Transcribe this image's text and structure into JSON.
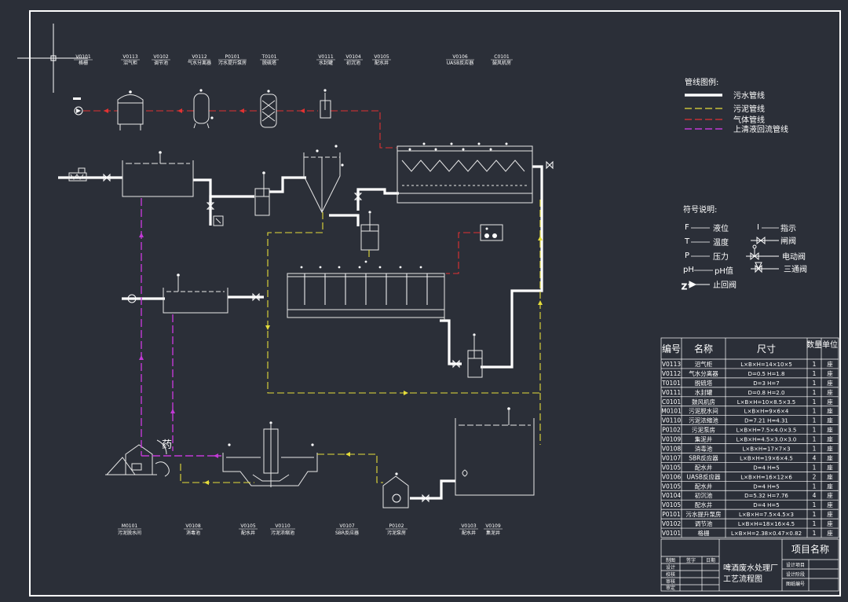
{
  "top_labels": [
    {
      "code": "V0101",
      "name": "格栅"
    },
    {
      "code": "V0113",
      "name": "沼气柜"
    },
    {
      "code": "V0102",
      "name": "调节池"
    },
    {
      "code": "V0112",
      "name": "气水分离器"
    },
    {
      "code": "P0101",
      "name": "污水提升泵房"
    },
    {
      "code": "T0101",
      "name": "脱硫塔"
    },
    {
      "code": "V0111",
      "name": "水封罐"
    },
    {
      "code": "V0104",
      "name": "初沉池"
    },
    {
      "code": "V0105",
      "name": "配水井"
    },
    {
      "code": "V0106",
      "name": "UASB反应器"
    },
    {
      "code": "C0101",
      "name": "鼓风机房"
    }
  ],
  "bottom_labels": [
    {
      "code": "M0101",
      "name": "污泥脱水间"
    },
    {
      "code": "V0108",
      "name": "消毒池"
    },
    {
      "code": "V0105",
      "name": "配水井"
    },
    {
      "code": "V0110",
      "name": "污泥浓缩池"
    },
    {
      "code": "V0107",
      "name": "SBR反应器"
    },
    {
      "code": "P0102",
      "name": "污泥泵房"
    },
    {
      "code": "V0103",
      "name": "配水井"
    },
    {
      "code": "V0109",
      "name": "集泥井"
    }
  ],
  "dose_label": "药",
  "legend": {
    "title": "管线图例:",
    "items": [
      {
        "label": "污水管线",
        "kind": "sewage"
      },
      {
        "label": "污泥管线",
        "kind": "sludge"
      },
      {
        "label": "气体管线",
        "kind": "gas"
      },
      {
        "label": "上清液回流管线",
        "kind": "return"
      }
    ]
  },
  "symbols": {
    "title": "符号说明:",
    "items": [
      {
        "key": "F",
        "label": "液位"
      },
      {
        "key": "T",
        "label": "温度"
      },
      {
        "key": "P",
        "label": "压力"
      },
      {
        "key": "pH",
        "label": "pH值"
      },
      {
        "key": "I",
        "label": "指示"
      },
      {
        "key": "",
        "label": "闸阀"
      },
      {
        "key": "",
        "label": "电动阀"
      },
      {
        "key": "",
        "label": "三通阀"
      },
      {
        "key": "",
        "label": "止回阀"
      }
    ]
  },
  "equipment_table": {
    "headers": [
      "编号",
      "名称",
      "尺寸",
      "数量",
      "单位"
    ],
    "rows": [
      [
        "V0113",
        "沼气柜",
        "L×B×H=14×10×5",
        "1",
        "座"
      ],
      [
        "V0112",
        "气水分离器",
        "D=0.5  H=1.8",
        "1",
        "座"
      ],
      [
        "T0101",
        "脱硫塔",
        "D=3   H=7",
        "1",
        "座"
      ],
      [
        "V0111",
        "水封罐",
        "D=0.8  H=2.0",
        "1",
        "座"
      ],
      [
        "C0101",
        "鼓风机房",
        "L×B×H=10×8.5×3.5",
        "1",
        "座"
      ],
      [
        "M0101",
        "污泥脱水间",
        "L×B×H=9×6×4",
        "1",
        "座"
      ],
      [
        "V0110",
        "污泥浓缩池",
        "D=7.21  H=4.31",
        "1",
        "座"
      ],
      [
        "P0102",
        "污泥泵房",
        "L×B×H=7.5×4.0×3.5",
        "1",
        "座"
      ],
      [
        "V0109",
        "集泥井",
        "L×B×H=4.5×3.0×3.0",
        "1",
        "座"
      ],
      [
        "V0108",
        "消毒池",
        "L×B×H=17×7×3",
        "1",
        "座"
      ],
      [
        "V0107",
        "SBR反应器",
        "L×B×H=19×6×4.5",
        "4",
        "座"
      ],
      [
        "V0105",
        "配水井",
        "D=4   H=5",
        "1",
        "座"
      ],
      [
        "V0106",
        "UASB反应器",
        "L×B×H=16×12×6",
        "2",
        "座"
      ],
      [
        "V0105",
        "配水井",
        "D=4   H=5",
        "1",
        "座"
      ],
      [
        "V0104",
        "初沉池",
        "D=5.32  H=7.76",
        "4",
        "座"
      ],
      [
        "V0105",
        "配水井",
        "D=4   H=5",
        "1",
        "座"
      ],
      [
        "P0101",
        "污水提升泵房",
        "L×B×H=7.5×4.5×3",
        "1",
        "座"
      ],
      [
        "V0102",
        "调节池",
        "L×B×H=18×16×4.5",
        "1",
        "座"
      ],
      [
        "V0101",
        "格栅",
        "L×B×H=2.38×0.47×0.82",
        "1",
        "座"
      ]
    ]
  },
  "title_block": {
    "project": "项目名称",
    "drawing_title_1": "啤酒废水处理厂",
    "drawing_title_2": "工艺流程图",
    "col_headers": [
      "签字",
      "日期"
    ],
    "side_rows": [
      "制图",
      "设计",
      "校核",
      "审核",
      "审定"
    ],
    "meta": [
      "设计项目",
      "设计阶段",
      "图纸编号"
    ]
  },
  "colors": {
    "background": "#2b2f38",
    "sewage": "#ffffff",
    "sludge": "#e5dd3a",
    "gas": "#e23232",
    "return": "#c23ad6"
  }
}
